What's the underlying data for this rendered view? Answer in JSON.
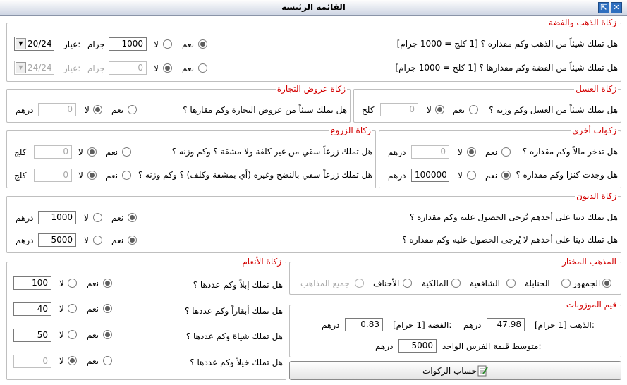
{
  "window": {
    "title": "القائمة الرئيسة",
    "btn_restore": "⇱",
    "btn_close": "✕"
  },
  "gold": {
    "legend": "زكاة الذهب والفضة",
    "gold_q": "هل تملك شيئاً من الذهب وكم مقداره ؟ [1 كلج = 1000 جرام]",
    "silver_q": "هل تملك شيئاً من الفضة وكم مقدارها ؟ [1 كلج = 1000 جرام]",
    "yes": "نعم",
    "no": "لا",
    "gram": "جرام",
    "karat_label": "عيار:",
    "gold_value": "1000",
    "gold_karat": "20/24",
    "silver_value": "0",
    "silver_karat": "24/24"
  },
  "honey": {
    "legend": "زكاة العسل",
    "q": "هل تملك شيئاً من العسل وكم وزنه ؟",
    "yes": "نعم",
    "no": "لا",
    "value": "0",
    "unit": "كلج"
  },
  "trade": {
    "legend": "زكاة عروض التجارة",
    "q": "هل تملك شيئاً من عروض التجارة وكم مقارها ؟",
    "yes": "نعم",
    "no": "لا",
    "value": "0",
    "unit": "درهم"
  },
  "other": {
    "legend": "زكوات أخرى",
    "q1": "هل تدخر مالاً وكم مقداره ؟",
    "q1_value": "0",
    "q1_unit": "درهم",
    "q2": "هل وجدت كنزا وكم مقداره ؟",
    "q2_value": "100000",
    "q2_unit": "درهم",
    "yes": "نعم",
    "no": "لا"
  },
  "crops": {
    "legend": "زكاة الزروع",
    "q1": "هل تملك زرعاً سقي من غير كلفة ولا مشقة ؟ وكم وزنه ؟",
    "q2": "هل تملك زرعاً سقي بالنضح وغيره (أي بمشقة وكلف) ؟ وكم وزنه ؟",
    "yes": "نعم",
    "no": "لا",
    "q1_value": "0",
    "q2_value": "0",
    "unit": "كلج"
  },
  "debts": {
    "legend": "زكاة الديون",
    "q1": "هل تملك دينا على أحدهم يُرجى الحصول عليه وكم مقداره ؟",
    "q2": "هل تملك دينا على أحدهم لا يُرجى الحصول عليه وكم مقداره ؟",
    "yes": "نعم",
    "no": "لا",
    "q1_value": "1000",
    "q2_value": "5000",
    "unit": "درهم"
  },
  "livestock": {
    "legend": "زكاة الأنعام",
    "q1": "هل تملك إبلاً وكم عددها ؟",
    "q2": "هل تملك أبقاراً وكم عددها ؟",
    "q3": "هل تملك شياهً وكم عددها ؟",
    "q4": "هل تملك خيلاً وكم عددها ؟",
    "yes": "نعم",
    "no": "لا",
    "v1": "100",
    "v2": "40",
    "v3": "50",
    "v4": "0"
  },
  "madhab": {
    "legend": "المذهب المختار",
    "options": [
      "الجمهور",
      "الحنابلة",
      "الشافعية",
      "المالكية",
      "الأحناف",
      "جميع المذاهب"
    ]
  },
  "weights": {
    "legend": "قيم الموزونات",
    "gold_label": "الذهب [1 جرام]:",
    "gold_value": "47.98",
    "silver_label": "الفضة [1 جرام]:",
    "silver_value": "0.83",
    "horse_label": "متوسط قيمة الفرس الواحد:",
    "horse_value": "5000",
    "unit": "درهم"
  },
  "calc": {
    "label": "حساب الزكوات"
  }
}
